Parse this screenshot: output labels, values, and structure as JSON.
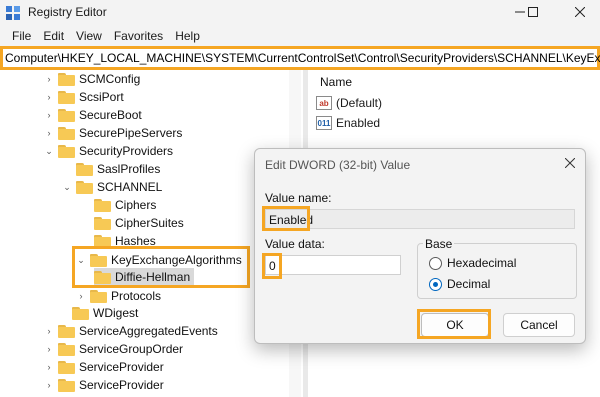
{
  "window": {
    "title": "Registry Editor"
  },
  "menu": [
    "File",
    "Edit",
    "View",
    "Favorites",
    "Help"
  ],
  "address": "Computer\\HKEY_LOCAL_MACHINE\\SYSTEM\\CurrentControlSet\\Control\\SecurityProviders\\SCHANNEL\\KeyExch",
  "tree": [
    "SCMConfig",
    "ScsiPort",
    "SecureBoot",
    "SecurePipeServers",
    "SecurityProviders",
    "SaslProfiles",
    "SCHANNEL",
    "Ciphers",
    "CipherSuites",
    "Hashes",
    "KeyExchangeAlgorithms",
    "Diffie-Hellman",
    "Protocols",
    "WDigest",
    "ServiceAggregatedEvents",
    "ServiceGroupOrder",
    "ServiceProvider",
    "ServiceProvider"
  ],
  "list": {
    "header": "Name",
    "items": [
      {
        "icon": "ab",
        "name": "(Default)"
      },
      {
        "icon": "011",
        "name": "Enabled"
      }
    ]
  },
  "dialog": {
    "title": "Edit DWORD (32-bit) Value",
    "value_name_label": "Value name:",
    "value_name": "Enabled",
    "value_data_label": "Value data:",
    "value_data": "0",
    "base_label": "Base",
    "hex_label": "Hexadecimal",
    "dec_label": "Decimal",
    "ok": "OK",
    "cancel": "Cancel"
  },
  "colors": {
    "highlight": "#f5a623",
    "accent": "#0067c0",
    "folder": "#f7c955"
  }
}
